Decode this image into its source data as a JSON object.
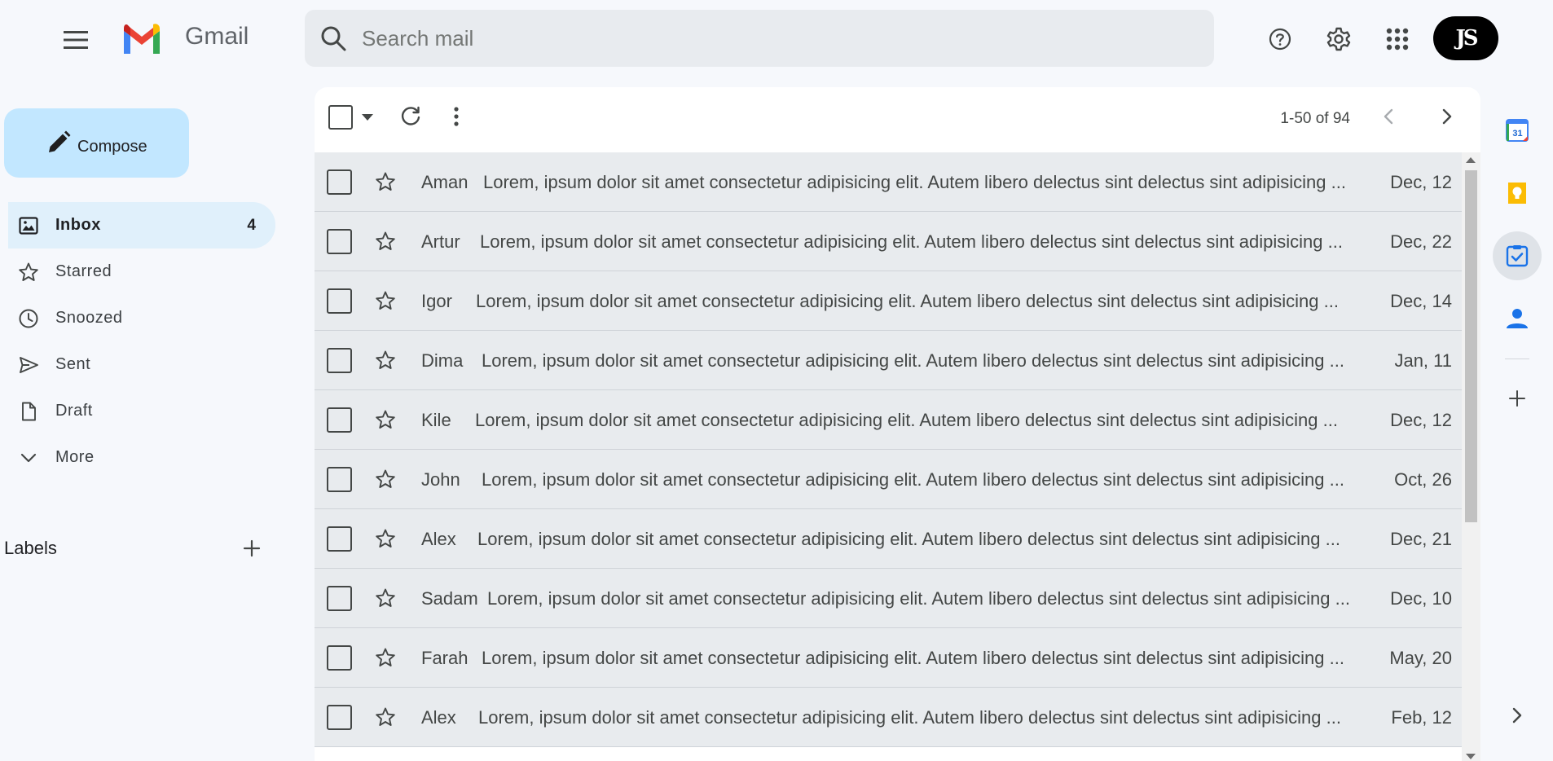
{
  "header": {
    "brand": "Gmail",
    "search_placeholder": "Search mail",
    "support_icon": "help-circle-icon",
    "settings_icon": "gear-icon",
    "apps_icon": "apps-grid-icon",
    "avatar_text": "JS"
  },
  "sidebar": {
    "compose_label": "Compose",
    "items": [
      {
        "label": "Inbox",
        "icon": "inbox-icon",
        "count": "4",
        "active": true
      },
      {
        "label": "Starred",
        "icon": "star-icon",
        "count": "",
        "active": false
      },
      {
        "label": "Snoozed",
        "icon": "clock-icon",
        "count": "",
        "active": false
      },
      {
        "label": "Sent",
        "icon": "send-icon",
        "count": "",
        "active": false
      },
      {
        "label": "Draft",
        "icon": "draft-icon",
        "count": "",
        "active": false
      },
      {
        "label": "More",
        "icon": "chevron-down-icon",
        "count": "",
        "active": false
      }
    ],
    "labels_title": "Labels"
  },
  "toolbar": {
    "pager_text": "1-50 of 94"
  },
  "emails": [
    {
      "sender": "Aman",
      "snippet": "Lorem, ipsum dolor sit amet consectetur adipisicing elit. Autem libero delectus sint delectus sint adipisicing ...",
      "date": "Dec, 12"
    },
    {
      "sender": "Artur",
      "snippet": "Lorem, ipsum dolor sit amet consectetur adipisicing elit. Autem libero delectus sint delectus sint adipisicing ...",
      "date": "Dec, 22"
    },
    {
      "sender": "Igor",
      "snippet": "Lorem, ipsum dolor sit amet consectetur adipisicing elit. Autem libero delectus sint delectus sint adipisicing ...",
      "date": "Dec, 14"
    },
    {
      "sender": "Dima",
      "snippet": "Lorem, ipsum dolor sit amet consectetur adipisicing elit. Autem libero delectus sint delectus sint adipisicing ...",
      "date": "Jan, 11"
    },
    {
      "sender": "Kile",
      "snippet": "Lorem, ipsum dolor sit amet consectetur adipisicing elit. Autem libero delectus sint delectus sint adipisicing ...",
      "date": "Dec, 12"
    },
    {
      "sender": "John",
      "snippet": "Lorem, ipsum dolor sit amet consectetur adipisicing elit. Autem libero delectus sint delectus sint adipisicing ...",
      "date": "Oct, 26"
    },
    {
      "sender": "Alex",
      "snippet": "Lorem, ipsum dolor sit amet consectetur adipisicing elit. Autem libero delectus sint delectus sint adipisicing ...",
      "date": "Dec, 21"
    },
    {
      "sender": "Sadam",
      "snippet": "Lorem, ipsum dolor sit amet consectetur adipisicing elit. Autem libero delectus sint delectus sint adipisicing ...",
      "date": "Dec, 10"
    },
    {
      "sender": "Farah",
      "snippet": "Lorem, ipsum dolor sit amet consectetur adipisicing elit. Autem libero delectus sint delectus sint adipisicing ...",
      "date": "May, 20"
    },
    {
      "sender": "Alex",
      "snippet": "Lorem, ipsum dolor sit amet consectetur adipisicing elit. Autem libero delectus sint delectus sint adipisicing ...",
      "date": "Feb, 12"
    }
  ],
  "side_panel": {
    "calendar_day": "31",
    "apps": [
      "calendar-icon",
      "keep-icon",
      "tasks-icon",
      "contacts-icon"
    ],
    "add_icon": "plus-icon",
    "expand_icon": "chevron-right-icon"
  },
  "colors": {
    "background": "#f6f8fc",
    "active_nav": "#e0f0fb",
    "compose": "#c2e7ff",
    "row": "#e8ebee"
  }
}
